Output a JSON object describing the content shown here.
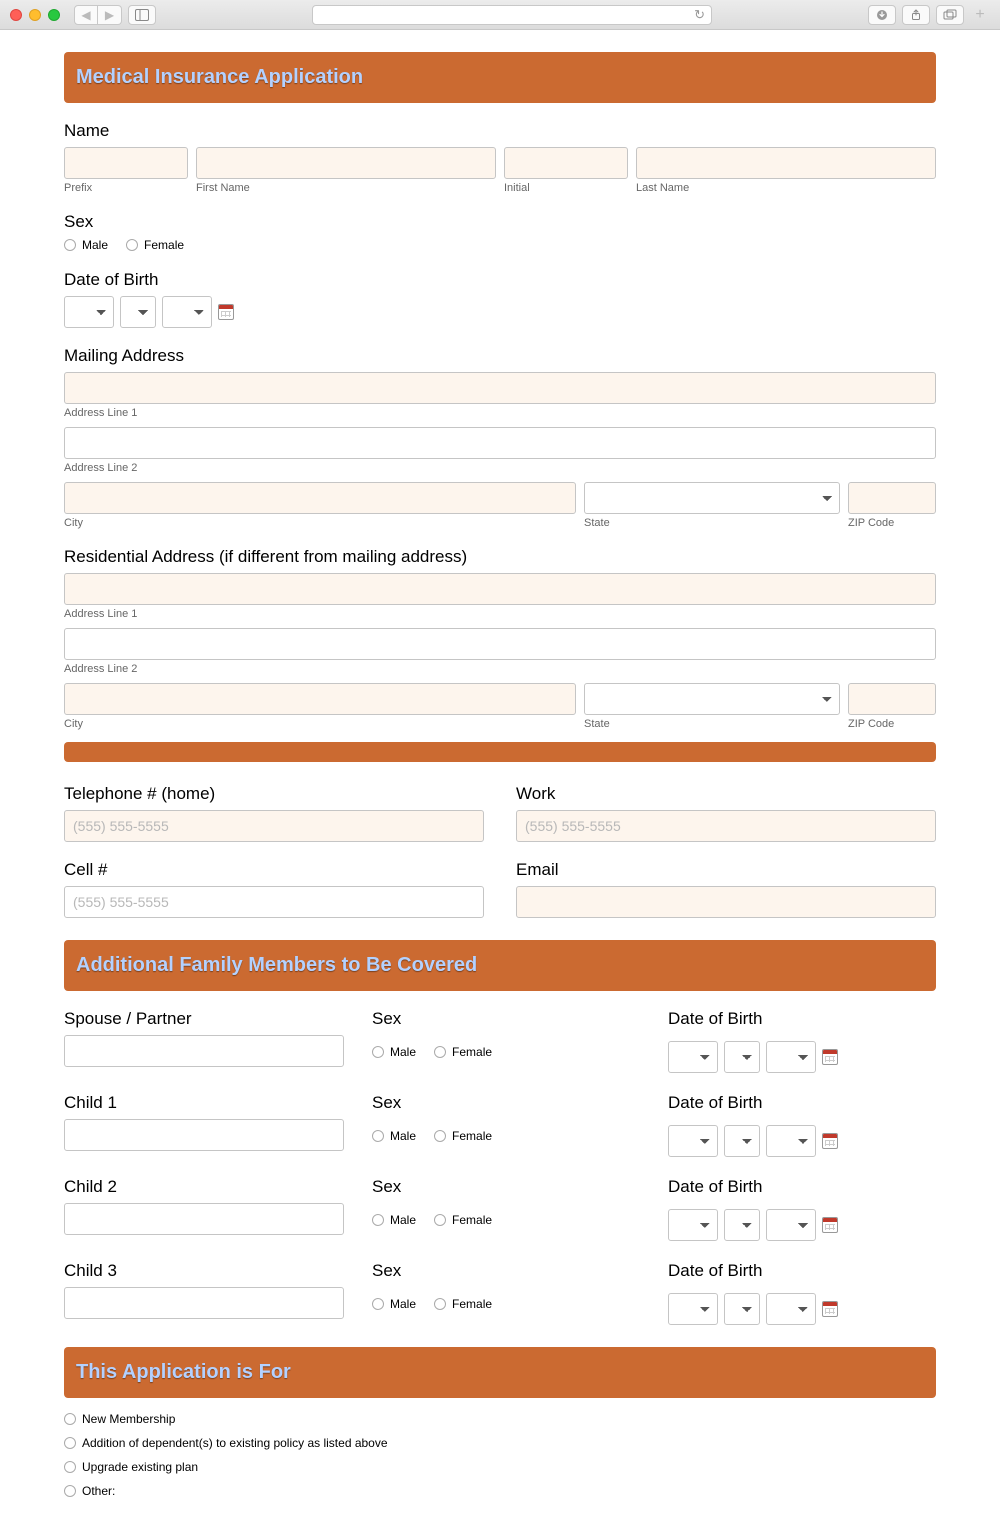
{
  "colors": {
    "header_bg": "#cb6a31",
    "header_text": "#b3d1ff",
    "tinted_input": "#fdf5ed"
  },
  "headers": {
    "main": "Medical Insurance Application",
    "family": "Additional Family Members to Be Covered",
    "app_for": "This Application is For"
  },
  "name": {
    "label": "Name",
    "prefix": "Prefix",
    "first": "First Name",
    "initial": "Initial",
    "last": "Last Name"
  },
  "sex": {
    "label": "Sex",
    "male": "Male",
    "female": "Female"
  },
  "dob": {
    "label": "Date of Birth"
  },
  "mailing": {
    "label": "Mailing Address",
    "line1": "Address Line 1",
    "line2": "Address Line 2",
    "city": "City",
    "state": "State",
    "zip": "ZIP Code"
  },
  "residential": {
    "label": "Residential Address (if different from mailing address)",
    "line1": "Address Line 1",
    "line2": "Address Line 2",
    "city": "City",
    "state": "State",
    "zip": "ZIP Code"
  },
  "phones": {
    "home": "Telephone # (home)",
    "work": "Work",
    "cell": "Cell #",
    "email": "Email",
    "placeholder": "(555) 555-5555"
  },
  "family": {
    "rows": [
      {
        "name_label": "Spouse / Partner"
      },
      {
        "name_label": "Child 1"
      },
      {
        "name_label": "Child 2"
      },
      {
        "name_label": "Child 3"
      }
    ],
    "sex_label": "Sex",
    "dob_label": "Date of Birth",
    "male": "Male",
    "female": "Female"
  },
  "app_for_options": [
    "New Membership",
    "Addition of dependent(s) to existing policy as listed above",
    "Upgrade existing plan",
    "Other:"
  ]
}
